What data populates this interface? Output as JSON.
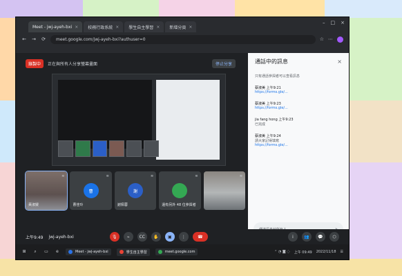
{
  "browser": {
    "tabs": [
      {
        "label": "Meet - jwj-ayeh-bxi"
      },
      {
        "label": "校務行政系統"
      },
      {
        "label": "學生自主學習"
      },
      {
        "label": "新增分頁"
      }
    ],
    "url": "meet.google.com/jwj-ayeh-bxi?authuser=0"
  },
  "meet": {
    "recording_label": "錄製中",
    "present_title": "正在與所有人分享螢幕畫面",
    "stop_label": "停止分享",
    "participants": [
      {
        "name": "黃淑媛",
        "initials": "",
        "color": "#2b5fc7"
      },
      {
        "name": "曹佳玲",
        "initials": "曹",
        "color": "#1a73e8"
      },
      {
        "name": "謝佩蓉",
        "initials": "謝",
        "color": "#2b5fc7"
      },
      {
        "name": "還有另外 48 位參與者",
        "initials": "",
        "color": "#34a853"
      },
      {
        "name": "",
        "initials": "",
        "color": "#8f8f8f"
      }
    ],
    "meeting_code": "jwj-ayeh-bxi",
    "time": "上午9:49"
  },
  "chat": {
    "title": "通話中的訊息",
    "messages": [
      {
        "meta": "",
        "text": "只有通話參與者可以查看訊息",
        "link": ""
      },
      {
        "meta": "蔡淑美 上午9:21",
        "text": "",
        "link": "https://forms.gle/..."
      },
      {
        "meta": "蔡淑美 上午9:23",
        "text": "",
        "link": "https://forms.gle/..."
      },
      {
        "meta": "jia fang hong 上午9:23",
        "text": "已完成",
        "link": ""
      },
      {
        "meta": "蔡淑美 上午9:24",
        "text": "請大家記得填寫",
        "link": "https://forms.gle/..."
      }
    ],
    "input_placeholder": "傳送訊息給所有人"
  },
  "taskbar": {
    "apps": [
      {
        "label": "Meet - jwj-ayeh-bxi",
        "color": "#2a72e6"
      },
      {
        "label": "學生自主學習",
        "color": "#e94335"
      },
      {
        "label": "meet.google.com",
        "color": "#34a853"
      }
    ],
    "time": "上午 09:49",
    "date": "2022/11/18"
  }
}
